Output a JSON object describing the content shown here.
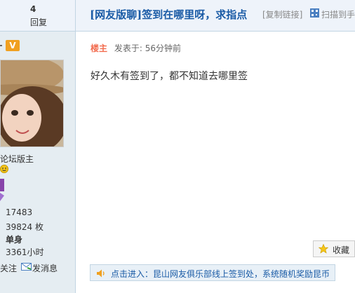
{
  "header": {
    "reply_count": "4",
    "reply_label": "回复",
    "title": "[网友版聊]签到在哪里呀，求指点",
    "copy_link": "[复制链接]",
    "scan_text": "扫描到手"
  },
  "sidebar": {
    "v_badge": "V",
    "rank_title": "论坛版主",
    "stats": [
      "17483",
      "39824 枚",
      "单身",
      "3361小时"
    ],
    "follow": "关注",
    "message": "发消息"
  },
  "post": {
    "author": "楼主",
    "posted": "发表于: 56分钟前",
    "content": "好久木有签到了，都不知道去哪里签"
  },
  "actions": {
    "favorite": "收藏"
  },
  "notice": {
    "text": "点击进入：昆山网友俱乐部线上签到处，系统随机奖励昆币"
  },
  "colors": {
    "title_blue": "#1a5ba6",
    "author_orange": "#f26c4f",
    "sidebar_bg": "#e5edf2",
    "header_bg": "#eef3fa"
  }
}
